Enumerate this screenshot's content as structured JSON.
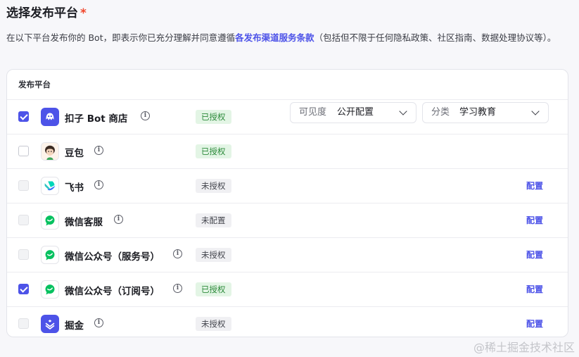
{
  "header": {
    "title": "选择发布平台",
    "required_mark": "*",
    "description_prefix": "在以下平台发布你的 Bot，即表示你已充分理解并同意遵循",
    "description_link": "各发布渠道服务条款",
    "description_suffix": "（包括但不限于任何隐私政策、社区指南、数据处理协议等）。"
  },
  "table": {
    "header": "发布平台",
    "rows": [
      {
        "name": "扣子 Bot 商店",
        "status": "已授权",
        "checked": true,
        "disabled": false,
        "icon": "coze-bot-store-icon",
        "config": ""
      },
      {
        "name": "豆包",
        "status": "已授权",
        "checked": false,
        "disabled": false,
        "icon": "doubao-avatar-icon",
        "config": ""
      },
      {
        "name": "飞书",
        "status": "未授权",
        "checked": false,
        "disabled": true,
        "icon": "feishu-icon",
        "config": "配置"
      },
      {
        "name": "微信客服",
        "status": "未配置",
        "checked": false,
        "disabled": true,
        "icon": "wechat-icon",
        "config": "配置"
      },
      {
        "name": "微信公众号（服务号）",
        "status": "未授权",
        "checked": false,
        "disabled": true,
        "icon": "wechat-icon",
        "config": "配置"
      },
      {
        "name": "微信公众号（订阅号）",
        "status": "已授权",
        "checked": true,
        "disabled": false,
        "icon": "wechat-icon",
        "config": "配置"
      },
      {
        "name": "掘金",
        "status": "未授权",
        "checked": false,
        "disabled": true,
        "icon": "juejin-icon",
        "config": "配置"
      }
    ]
  },
  "store_options": {
    "visibility_label": "可见度",
    "visibility_value": "公开配置",
    "category_label": "分类",
    "category_value": "学习教育"
  },
  "watermark": "@稀土掘金技术社区",
  "colors": {
    "accent": "#4d53e8",
    "authorized_bg": "#e3f5e5",
    "authorized_text": "#2c8a3a",
    "required": "#f0462b"
  }
}
